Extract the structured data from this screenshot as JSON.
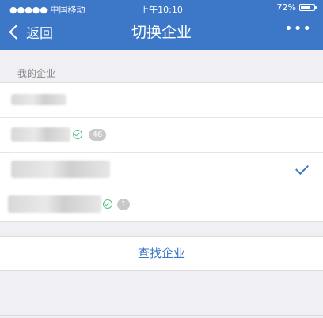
{
  "status_bar": {
    "carrier": "●●●●● 中国移动",
    "time": "上午10:10",
    "battery": "72%",
    "battery_level": 0.72
  },
  "nav": {
    "back_label": "返回",
    "title": "切换企业",
    "more_label": "•••"
  },
  "section": {
    "label": "我的企业"
  },
  "companies": [
    {
      "name": "",
      "verified": false,
      "badge": "",
      "selected": false
    },
    {
      "name": "",
      "verified": true,
      "badge": "46",
      "selected": false
    },
    {
      "name": "",
      "verified": false,
      "badge": "",
      "selected": true
    },
    {
      "name": "",
      "verified": true,
      "badge": "1",
      "selected": false
    }
  ],
  "find_button": {
    "label": "查找企业"
  },
  "colors": {
    "accent": "#3d78c8",
    "background": "#efeff4",
    "verified": "#52c08a"
  }
}
